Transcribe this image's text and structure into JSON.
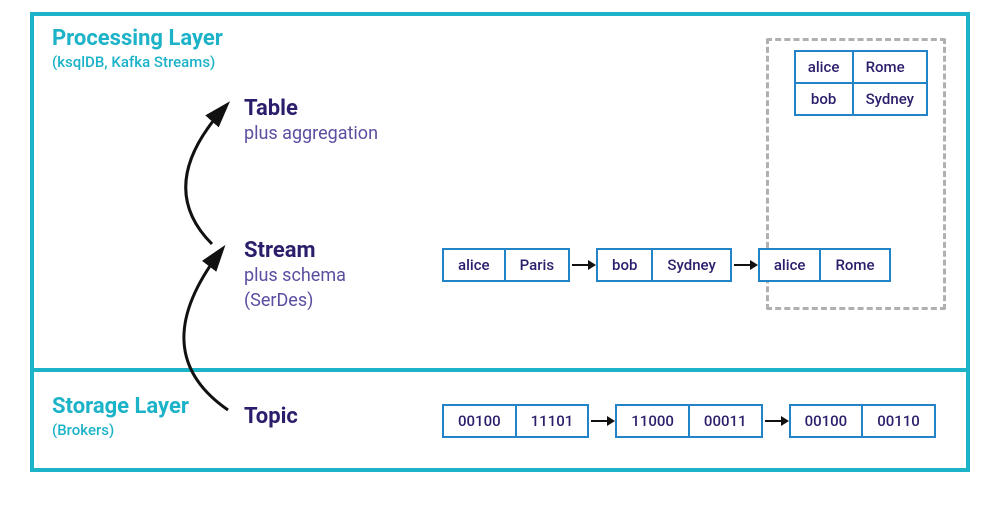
{
  "processing": {
    "title": "Processing Layer",
    "subtitle": "(ksqlDB, Kafka Streams)",
    "table": {
      "title": "Table",
      "sub": "plus aggregation",
      "rows": [
        {
          "key": "alice",
          "val": "Rome"
        },
        {
          "key": "bob",
          "val": "Sydney"
        }
      ]
    },
    "stream": {
      "title": "Stream",
      "sub1": "plus schema",
      "sub2": "(SerDes)",
      "records": [
        {
          "key": "alice",
          "val": "Paris"
        },
        {
          "key": "bob",
          "val": "Sydney"
        },
        {
          "key": "alice",
          "val": "Rome"
        }
      ]
    }
  },
  "storage": {
    "title": "Storage Layer",
    "subtitle": "(Brokers)",
    "topic": {
      "title": "Topic",
      "records": [
        {
          "key": "00100",
          "val": "11101"
        },
        {
          "key": "11000",
          "val": "00011"
        },
        {
          "key": "00100",
          "val": "00110"
        }
      ]
    }
  }
}
